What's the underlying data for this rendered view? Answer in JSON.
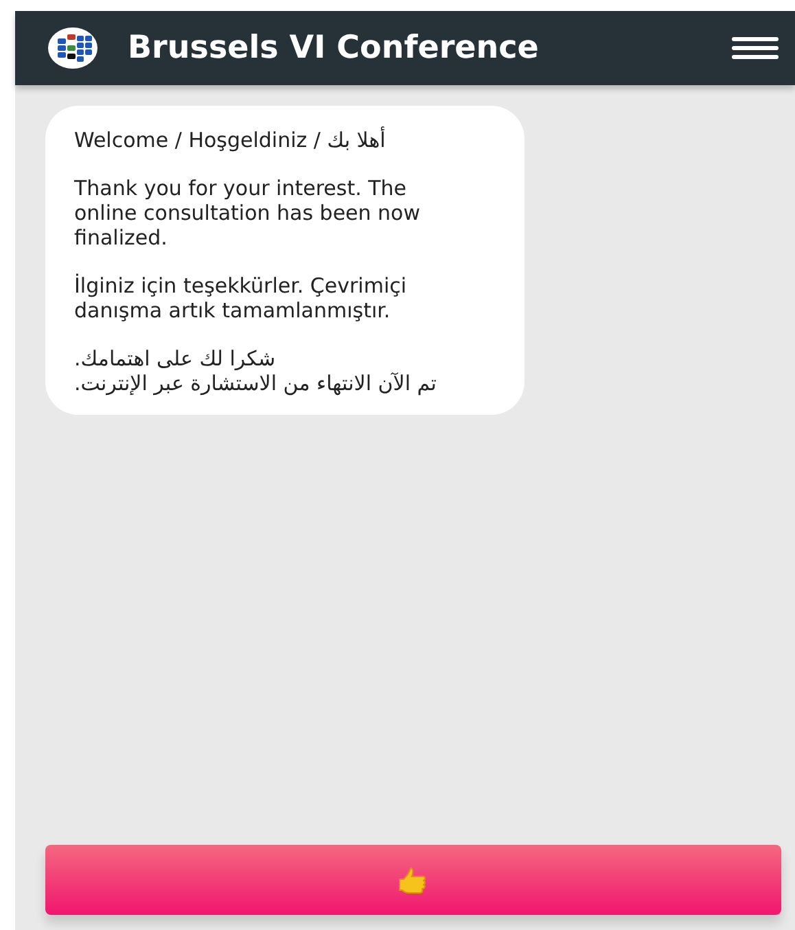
{
  "header": {
    "title": "Brussels VI Conference"
  },
  "message": {
    "paragraphs": [
      {
        "kind": "latin",
        "text": "Welcome / Hoşgeldiniz / أهلا بك"
      },
      {
        "kind": "latin",
        "text": "Thank you for your interest. The online consultation has been now finalized."
      },
      {
        "kind": "latin",
        "text": "İlginiz için teşekkürler. Çevrimiçi danışma artık tamamlanmıştır."
      },
      {
        "kind": "arabic",
        "text": "شكرا لك على اهتمامك.\nتم الآن الانتهاء من الاستشارة عبر الإنترنت."
      }
    ]
  },
  "action_button": {
    "kind": "thumbs-up"
  }
}
